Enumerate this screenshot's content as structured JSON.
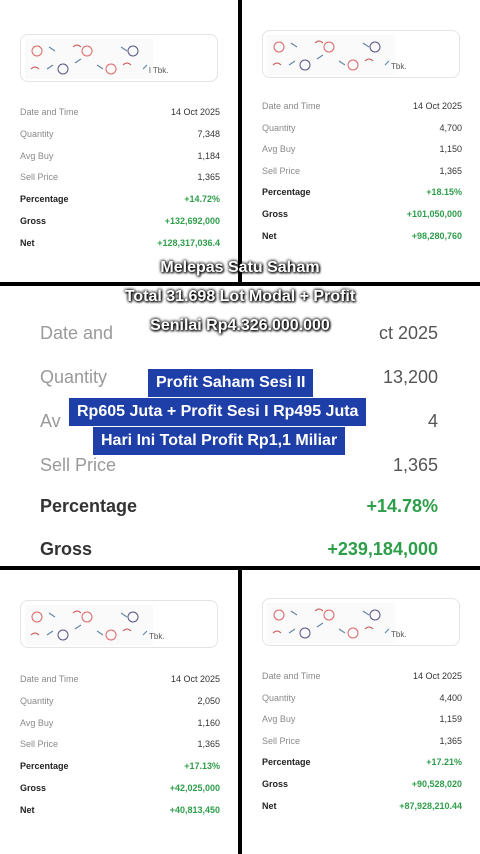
{
  "panels": {
    "top_left": {
      "logo_suffix": "l Tbk.",
      "rows": [
        {
          "label": "Date and Time",
          "value": "14 Oct 2025"
        },
        {
          "label": "Quantity",
          "value": "7,348"
        },
        {
          "label": "Avg Buy",
          "value": "1,184"
        },
        {
          "label": "Sell Price",
          "value": "1,365"
        },
        {
          "label": "Percentage",
          "value": "+14.72%"
        },
        {
          "label": "Gross",
          "value": "+132,692,000"
        },
        {
          "label": "Net",
          "value": "+128,317,036.4"
        }
      ]
    },
    "top_right": {
      "logo_suffix": "Tbk.",
      "rows": [
        {
          "label": "Date and Time",
          "value": "14 Oct 2025"
        },
        {
          "label": "Quantity",
          "value": "4,700"
        },
        {
          "label": "Avg Buy",
          "value": "1,150"
        },
        {
          "label": "Sell Price",
          "value": "1,365"
        },
        {
          "label": "Percentage",
          "value": "+18.15%"
        },
        {
          "label": "Gross",
          "value": "+101,050,000"
        },
        {
          "label": "Net",
          "value": "+98,280,760"
        }
      ]
    },
    "middle": {
      "rows": [
        {
          "label": "Date and",
          "value": "ct 2025"
        },
        {
          "label": "Quantity",
          "value": "13,200"
        },
        {
          "label": "Av",
          "value": "4"
        },
        {
          "label": "Sell Price",
          "value": "1,365"
        },
        {
          "label": "Percentage",
          "value": "+14.78%"
        },
        {
          "label": "Gross",
          "value": "+239,184,000"
        }
      ]
    },
    "bottom_left": {
      "logo_suffix": "Tbk.",
      "rows": [
        {
          "label": "Date and Time",
          "value": "14 Oct 2025"
        },
        {
          "label": "Quantity",
          "value": "2,050"
        },
        {
          "label": "Avg Buy",
          "value": "1,160"
        },
        {
          "label": "Sell Price",
          "value": "1,365"
        },
        {
          "label": "Percentage",
          "value": "+17.13%"
        },
        {
          "label": "Gross",
          "value": "+42,025,000"
        },
        {
          "label": "Net",
          "value": "+40,813,450"
        }
      ]
    },
    "bottom_right": {
      "logo_suffix": "Tbk.",
      "rows": [
        {
          "label": "Date and Time",
          "value": "14 Oct 2025"
        },
        {
          "label": "Quantity",
          "value": "4,400"
        },
        {
          "label": "Avg Buy",
          "value": "1,159"
        },
        {
          "label": "Sell Price",
          "value": "1,365"
        },
        {
          "label": "Percentage",
          "value": "+17.21%"
        },
        {
          "label": "Gross",
          "value": "+90,528,020"
        },
        {
          "label": "Net",
          "value": "+87,928,210.44"
        }
      ]
    }
  },
  "captions": {
    "top": [
      "Melepas Satu Saham",
      "Total 31.698 Lot Modal + Profit",
      "Senilai Rp4.326.000.000"
    ],
    "boxed": [
      "Profit Saham Sesi II",
      "Rp605 Juta + Profit Sesi I Rp495 Juta",
      "Hari Ini Total Profit Rp1,1 Miliar"
    ]
  },
  "colors": {
    "positive": "#2e9e4a",
    "caption_box": "#1f3fa8"
  }
}
